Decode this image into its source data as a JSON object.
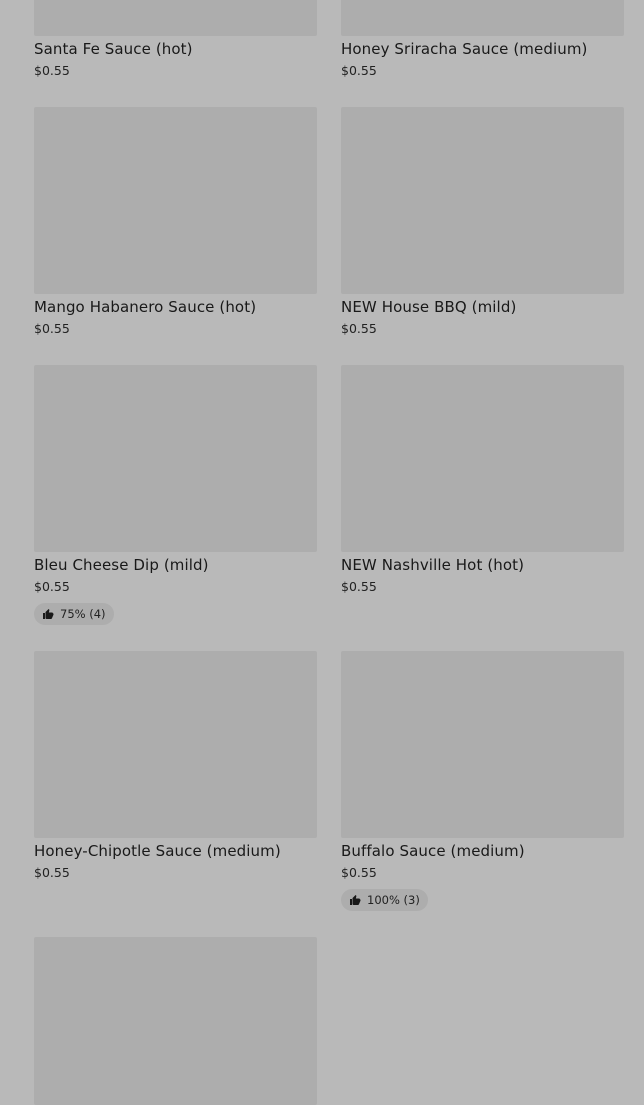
{
  "items": [
    {
      "name": "Santa Fe Sauce (hot)",
      "price": "$0.55"
    },
    {
      "name": "Honey Sriracha Sauce (medium)",
      "price": "$0.55"
    },
    {
      "name": "Mango Habanero Sauce (hot)",
      "price": "$0.55"
    },
    {
      "name": "NEW House BBQ (mild)",
      "price": "$0.55"
    },
    {
      "name": "Bleu Cheese Dip (mild)",
      "price": "$0.55",
      "rating": "75% (4)"
    },
    {
      "name": "NEW Nashville Hot (hot)",
      "price": "$0.55"
    },
    {
      "name": "Honey-Chipotle Sauce (medium)",
      "price": "$0.55"
    },
    {
      "name": "Buffalo Sauce (medium)",
      "price": "$0.55",
      "rating": "100% (3)"
    }
  ],
  "icons": {
    "rating": "thumbs-up-icon"
  },
  "colors": {
    "background": "#b9b9b9",
    "placeholder": "#adadad",
    "text": "#191919"
  }
}
